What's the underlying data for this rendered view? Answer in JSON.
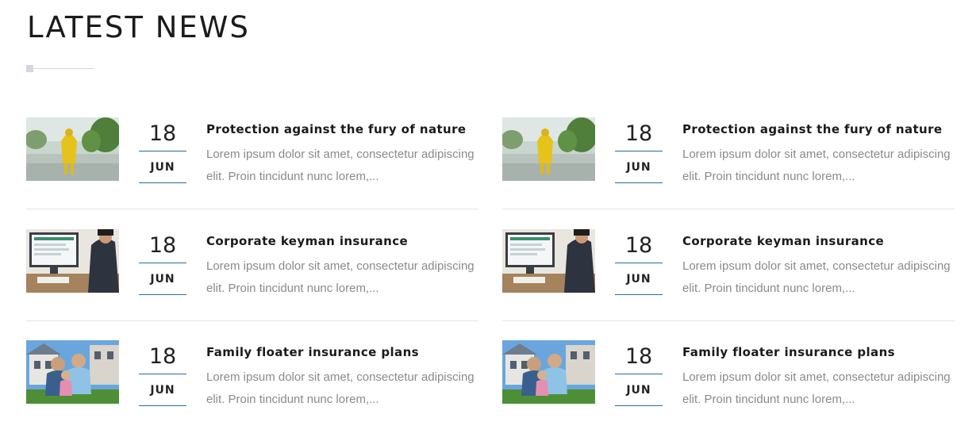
{
  "section": {
    "title": "LATEST NEWS"
  },
  "columns": [
    {
      "items": [
        {
          "image": "flood-person-raincoat-photo",
          "day": "18",
          "month": "JUN",
          "title": "Protection against the fury of nature",
          "excerpt": "Lorem ipsum dolor sit amet, consectetur adipiscing elit. Proin tincidunt nunc lorem,..."
        },
        {
          "image": "business-computer-desk-photo",
          "day": "18",
          "month": "JUN",
          "title": "Corporate keyman insurance",
          "excerpt": "Lorem ipsum dolor sit amet, consectetur adipiscing elit. Proin tincidunt nunc lorem,..."
        },
        {
          "image": "family-in-front-of-house-photo",
          "day": "18",
          "month": "JUN",
          "title": "Family floater insurance plans",
          "excerpt": "Lorem ipsum dolor sit amet, consectetur adipiscing elit. Proin tincidunt nunc lorem,..."
        }
      ]
    },
    {
      "items": [
        {
          "image": "flood-person-raincoat-photo",
          "day": "18",
          "month": "JUN",
          "title": "Protection against the fury of nature",
          "excerpt": "Lorem ipsum dolor sit amet, consectetur adipiscing elit. Proin tincidunt nunc lorem,..."
        },
        {
          "image": "business-computer-desk-photo",
          "day": "18",
          "month": "JUN",
          "title": "Corporate keyman insurance",
          "excerpt": "Lorem ipsum dolor sit amet, consectetur adipiscing elit. Proin tincidunt nunc lorem,..."
        },
        {
          "image": "family-in-front-of-house-photo",
          "day": "18",
          "month": "JUN",
          "title": "Family floater insurance plans",
          "excerpt": "Lorem ipsum dolor sit amet, consectetur adipiscing elit. Proin tincidunt nunc lorem,..."
        }
      ]
    }
  ],
  "colors": {
    "accent": "#2e6b93",
    "heading": "#1b1b1b",
    "excerpt": "#8a8a8a",
    "divider": "#e4e4e4"
  }
}
